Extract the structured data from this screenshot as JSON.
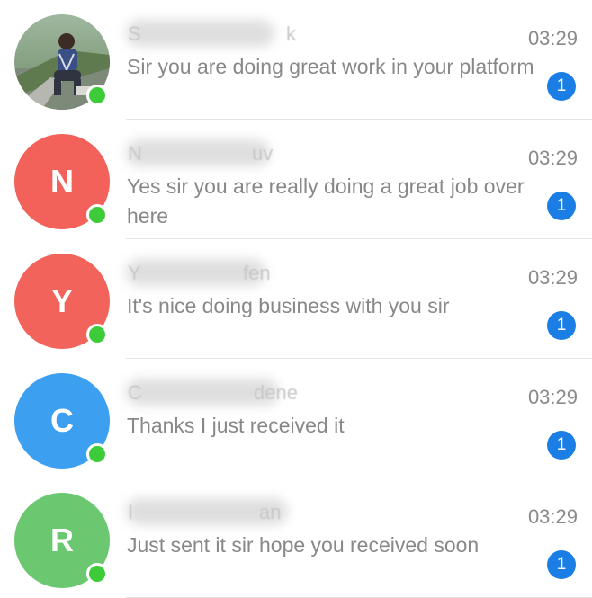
{
  "chats": [
    {
      "initial": "",
      "name_start": "S",
      "name_end": "k",
      "time": "03:29",
      "message": "Sir you are doing great work in your platform",
      "unread": "1",
      "avatar_color": "photo",
      "online": true
    },
    {
      "initial": "N",
      "name_start": "N",
      "name_end": "uv",
      "time": "03:29",
      "message": "Yes sir you are really doing a great job over here",
      "unread": "1",
      "avatar_color": "#f2625a",
      "online": true
    },
    {
      "initial": "Y",
      "name_start": "Y",
      "name_end": "fen",
      "time": "03:29",
      "message": "It's nice doing business with you sir",
      "unread": "1",
      "avatar_color": "#f2645b",
      "online": true
    },
    {
      "initial": "C",
      "name_start": "C",
      "name_end": "dene",
      "time": "03:29",
      "message": "Thanks I just received it",
      "unread": "1",
      "avatar_color": "#3c9ff0",
      "online": true
    },
    {
      "initial": "R",
      "name_start": "I",
      "name_end": "an",
      "time": "03:29",
      "message": "Just sent it sir hope you received soon",
      "unread": "1",
      "avatar_color": "#6cc870",
      "online": true
    }
  ],
  "colors": {
    "online": "#3ecb3a",
    "badge": "#1a7ee5",
    "preview_text": "#888888",
    "time_text": "#8a8a8a"
  }
}
